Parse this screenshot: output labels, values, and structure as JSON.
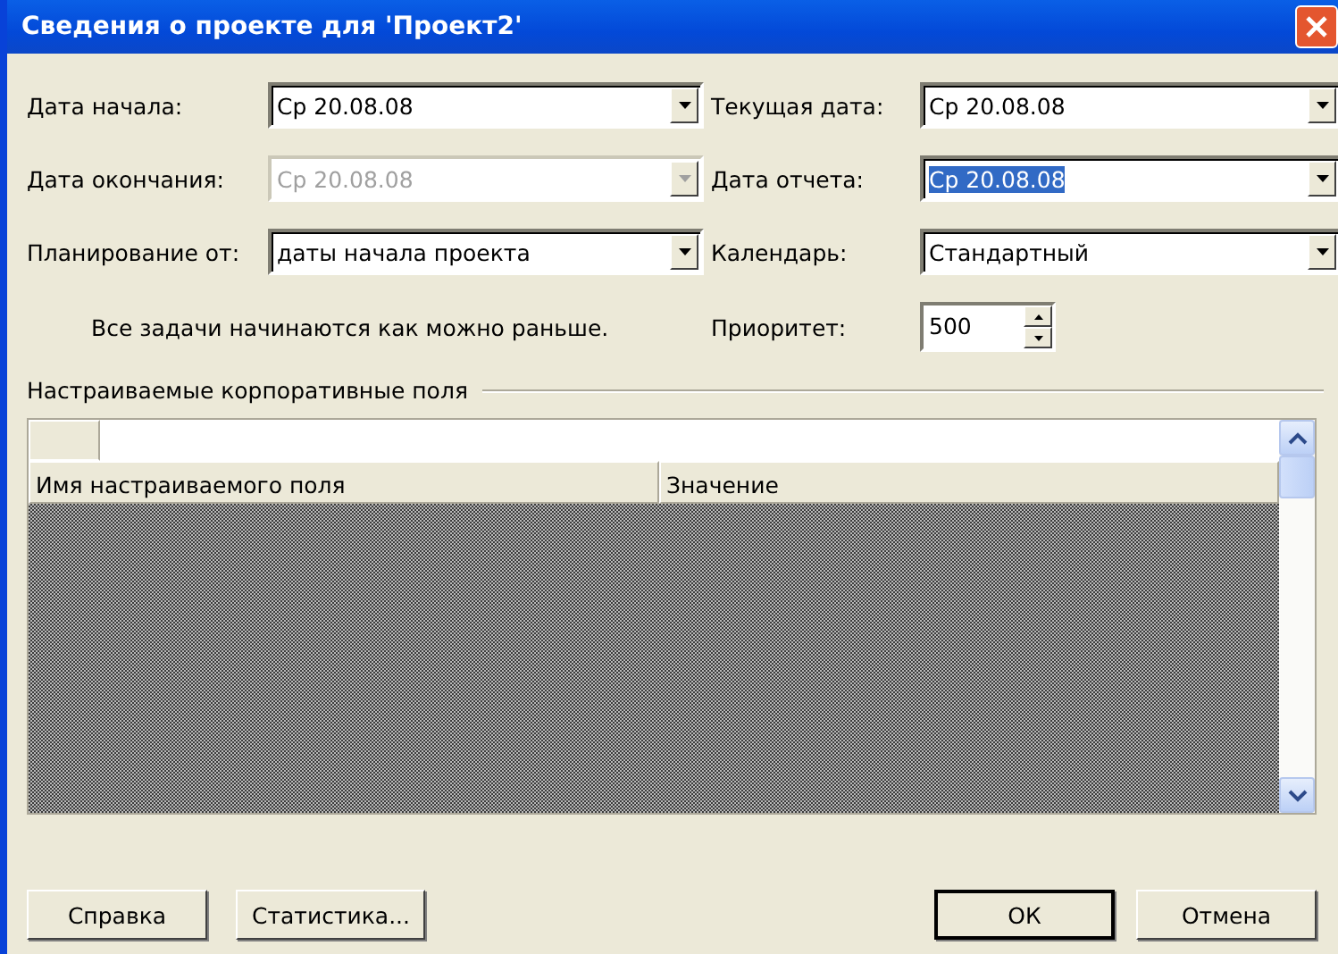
{
  "window": {
    "title": "Сведения о проекте для 'Проект2'"
  },
  "left_fields": [
    {
      "label": "Дата начала:",
      "value": "Ср 20.08.08",
      "disabled": false,
      "value_selected": false
    },
    {
      "label": "Дата окончания:",
      "value": "Ср 20.08.08",
      "disabled": true,
      "value_selected": false
    },
    {
      "label": "Планирование от:",
      "value": "даты начала проекта",
      "disabled": false,
      "value_selected": false
    }
  ],
  "right_fields": [
    {
      "label": "Текущая дата:",
      "value": "Ср 20.08.08",
      "disabled": false,
      "value_selected": false
    },
    {
      "label": "Дата отчета:",
      "value": "Ср 20.08.08",
      "disabled": false,
      "value_selected": true
    },
    {
      "label": "Календарь:",
      "value": "Стандартный",
      "disabled": false,
      "value_selected": false
    }
  ],
  "note": "Все задачи начинаются как можно раньше.",
  "priority": {
    "label": "Приоритет:",
    "value": "500"
  },
  "group_title": "Настраиваемые корпоративные поля",
  "grid": {
    "columns": [
      "Имя настраиваемого поля",
      "Значение"
    ]
  },
  "left_buttons": [
    {
      "label": "Справка",
      "default": false
    },
    {
      "label": "Статистика...",
      "default": false
    }
  ],
  "right_buttons": [
    {
      "label": "ОК",
      "default": true
    },
    {
      "label": "Отмена",
      "default": false
    }
  ]
}
